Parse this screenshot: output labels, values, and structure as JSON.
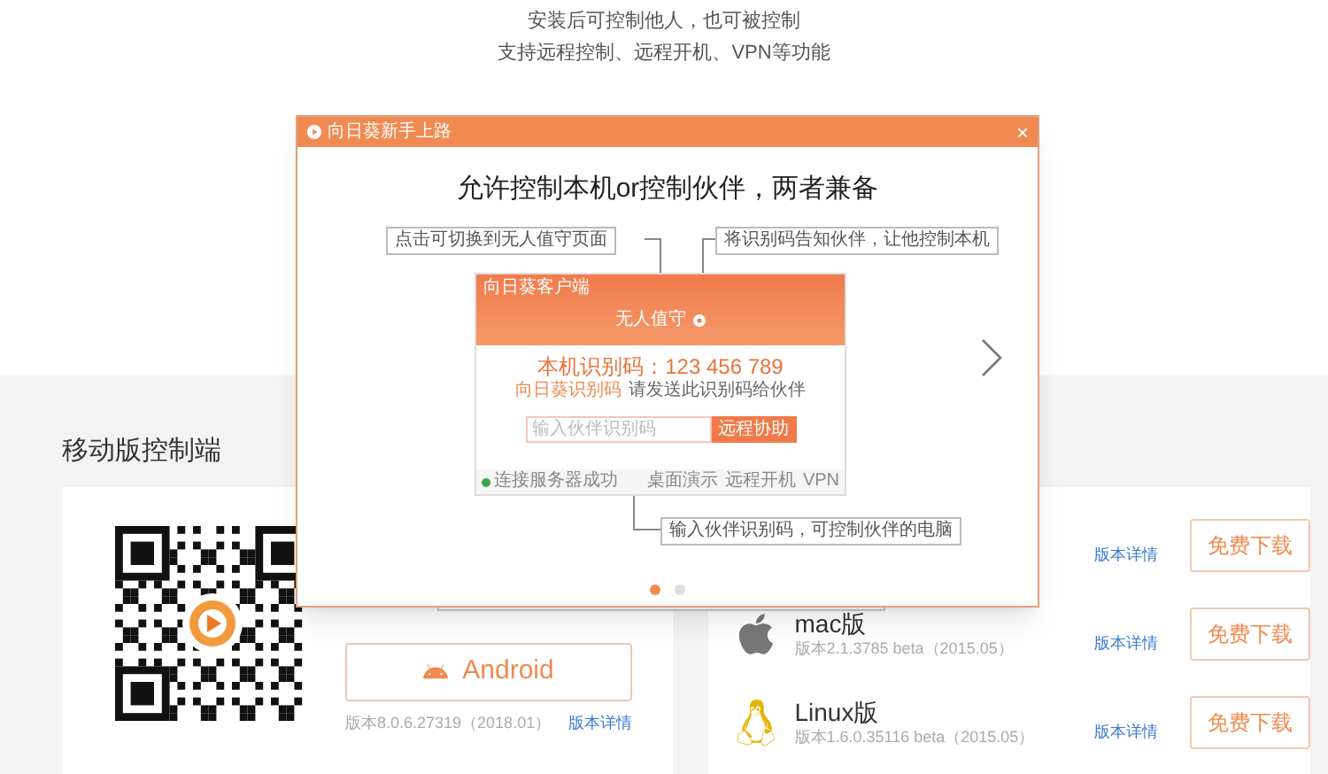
{
  "intro": [
    "安装后可控制他人，也可被控制",
    "支持远程控制、远程开机、VPN等功能"
  ],
  "section_title": "移动版控制端",
  "mobile": {
    "button": "Android",
    "version": "版本8.0.6.27319（2018.01）",
    "details_link": "版本详情"
  },
  "desktop": [
    {
      "details_link": "版本详情",
      "button": "免费下载"
    },
    {
      "kind": "apple",
      "name": "mac版",
      "version": "版本2.1.3785 beta（2015.05）",
      "details_link": "版本详情",
      "button": "免费下载"
    },
    {
      "kind": "linux",
      "name": "Linux版",
      "version": "版本1.6.0.35116 beta（2015.05）",
      "details_link": "版本详情",
      "button": "免费下载"
    }
  ],
  "dialog": {
    "title": "向日葵新手上路",
    "close": "×",
    "heading": "允许控制本机or控制伙伴，两者兼备",
    "callouts": [
      "点击可切换到无人值守页面",
      "将识别码告知伙伴，让他控制本机",
      "输入伙伴识别码，可控制伙伴的电脑"
    ],
    "preview": {
      "title": "向日葵客户端",
      "tab": "无人值守",
      "code": "本机识别码：123 456 789",
      "code_hint": "向日葵识别码",
      "code_note": "请发送此识别码给伙伴",
      "input_placeholder": "输入伙伴识别码",
      "connect_button": "远程协助",
      "status": "连接服务器成功",
      "footer": [
        "桌面演示",
        "远程开机",
        "VPN"
      ]
    },
    "pages": [
      {
        "selected": true
      },
      {
        "selected": false
      }
    ]
  }
}
